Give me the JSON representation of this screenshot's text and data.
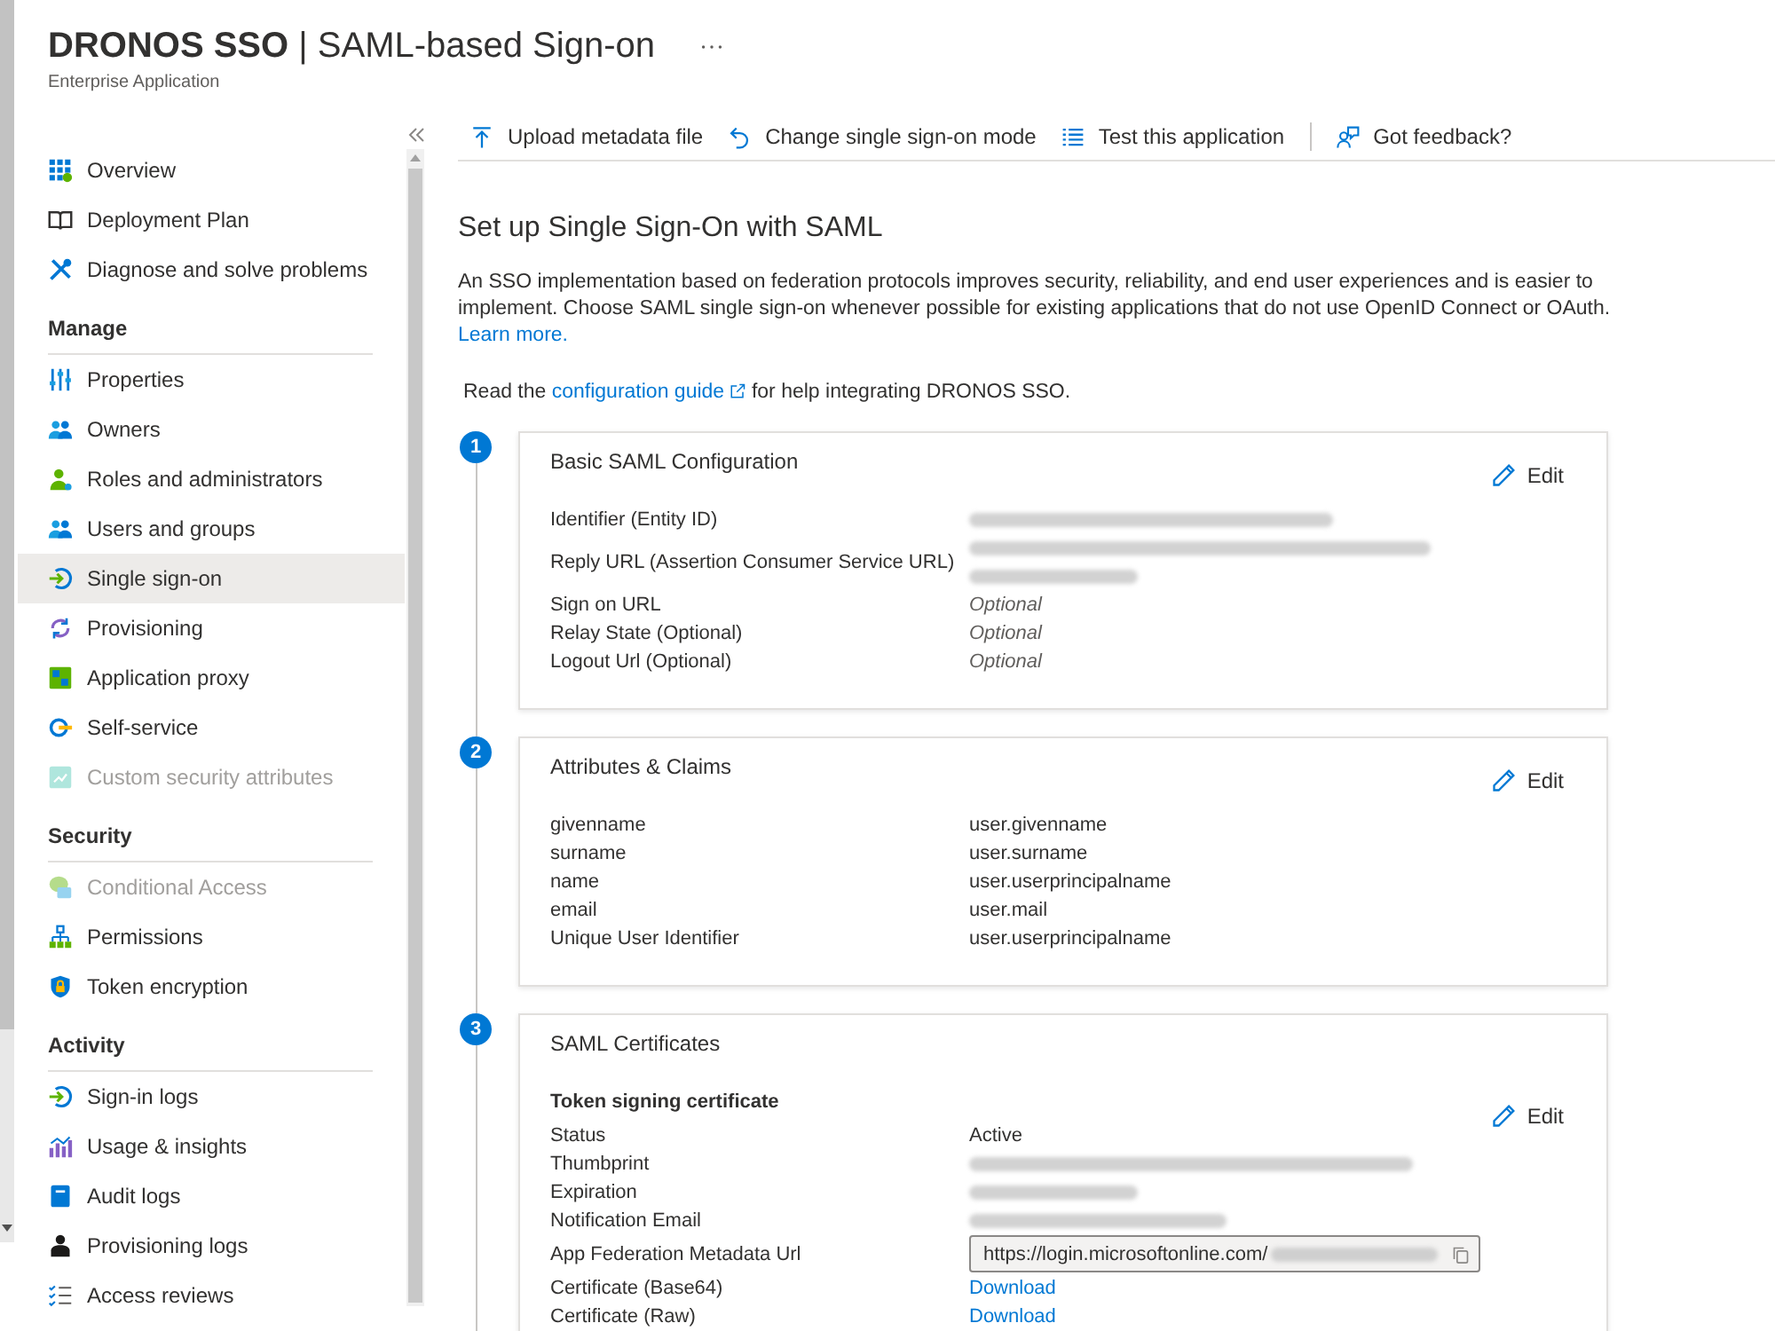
{
  "header": {
    "title": "**DRONOS SSO** | SAML-based Sign-on",
    "subtitle": "Enterprise Application"
  },
  "sidebar": {
    "sections": [
      {
        "items": [
          {
            "label": "Overview",
            "selected": false,
            "disabled": false
          },
          {
            "label": "Deployment Plan",
            "selected": false,
            "disabled": false
          },
          {
            "label": "Diagnose and solve problems",
            "selected": false,
            "disabled": false
          }
        ]
      },
      {
        "heading": "Manage",
        "items": [
          {
            "label": "Properties",
            "selected": false,
            "disabled": false
          },
          {
            "label": "Owners",
            "selected": false,
            "disabled": false
          },
          {
            "label": "Roles and administrators",
            "selected": false,
            "disabled": false
          },
          {
            "label": "Users and groups",
            "selected": false,
            "disabled": false
          },
          {
            "label": "Single sign-on",
            "selected": true,
            "disabled": false
          },
          {
            "label": "Provisioning",
            "selected": false,
            "disabled": false
          },
          {
            "label": "Application proxy",
            "selected": false,
            "disabled": false
          },
          {
            "label": "Self-service",
            "selected": false,
            "disabled": false
          },
          {
            "label": "Custom security attributes",
            "selected": false,
            "disabled": true
          }
        ]
      },
      {
        "heading": "Security",
        "items": [
          {
            "label": "Conditional Access",
            "selected": false,
            "disabled": true
          },
          {
            "label": "Permissions",
            "selected": false,
            "disabled": false
          },
          {
            "label": "Token encryption",
            "selected": false,
            "disabled": false
          }
        ]
      },
      {
        "heading": "Activity",
        "items": [
          {
            "label": "Sign-in logs",
            "selected": false,
            "disabled": false
          },
          {
            "label": "Usage & insights",
            "selected": false,
            "disabled": false
          },
          {
            "label": "Audit logs",
            "selected": false,
            "disabled": false
          },
          {
            "label": "Provisioning logs",
            "selected": false,
            "disabled": false
          },
          {
            "label": "Access reviews",
            "selected": false,
            "disabled": false
          }
        ]
      }
    ]
  },
  "toolbar": [
    {
      "items": [
        {
          "label": "Upload metadata file"
        },
        {
          "label": "Change single sign-on mode"
        },
        {
          "label": "Test this application"
        }
      ]
    },
    {
      "items": [
        {
          "label": "Got feedback?"
        }
      ]
    }
  ],
  "intro": {
    "heading": "Set up Single Sign-On with SAML",
    "description": "An SSO implementation based on federation protocols improves security, reliability, and end user experiences and is easier to implement. Choose SAML single sign-on whenever possible for existing applications that do not use OpenID Connect or OAuth.",
    "learn_more": "Learn more.",
    "guide_before": "Read the",
    "guide_link": "configuration guide",
    "guide_after": "for help integrating DRONOS SSO."
  },
  "steps": [
    {
      "number": "1",
      "title": "Basic SAML Configuration",
      "edit": "Edit",
      "rows": [
        {
          "label": "Identifier (Entity ID)",
          "kind": "redacted"
        },
        {
          "label": "Reply URL (Assertion Consumer Service URL)",
          "kind": "redacted_long"
        },
        {
          "label": "Sign on URL",
          "kind": "placeholder",
          "placeholder": "Optional"
        },
        {
          "label": "Relay State (Optional)",
          "kind": "placeholder",
          "placeholder": "Optional"
        },
        {
          "label": "Logout Url (Optional)",
          "kind": "placeholder",
          "placeholder": "Optional"
        }
      ]
    },
    {
      "number": "2",
      "title": "Attributes & Claims",
      "edit": "Edit",
      "rows": [
        {
          "label": "givenname",
          "kind": "text",
          "value": "user.givenname"
        },
        {
          "label": "surname",
          "kind": "text",
          "value": "user.surname"
        },
        {
          "label": "name",
          "kind": "text",
          "value": "user.userprincipalname"
        },
        {
          "label": "email",
          "kind": "text",
          "value": "user.mail"
        },
        {
          "label": "Unique User Identifier",
          "kind": "text",
          "value": "user.userprincipalname"
        }
      ]
    },
    {
      "number": "3",
      "title": "SAML Certificates",
      "subheading": "Token signing certificate",
      "edit": "Edit",
      "rows": [
        {
          "label": "Status",
          "kind": "text",
          "value": "Active"
        },
        {
          "label": "Thumbprint",
          "kind": "redacted"
        },
        {
          "label": "Expiration",
          "kind": "redacted"
        },
        {
          "label": "Notification Email",
          "kind": "redacted"
        },
        {
          "label": "App Federation Metadata Url",
          "kind": "url_field",
          "value": "https://login.microsoftonline.com/"
        },
        {
          "label": "Certificate (Base64)",
          "kind": "link",
          "value": "Download"
        },
        {
          "label": "Certificate (Raw)",
          "kind": "link",
          "value": "Download"
        }
      ]
    }
  ]
}
